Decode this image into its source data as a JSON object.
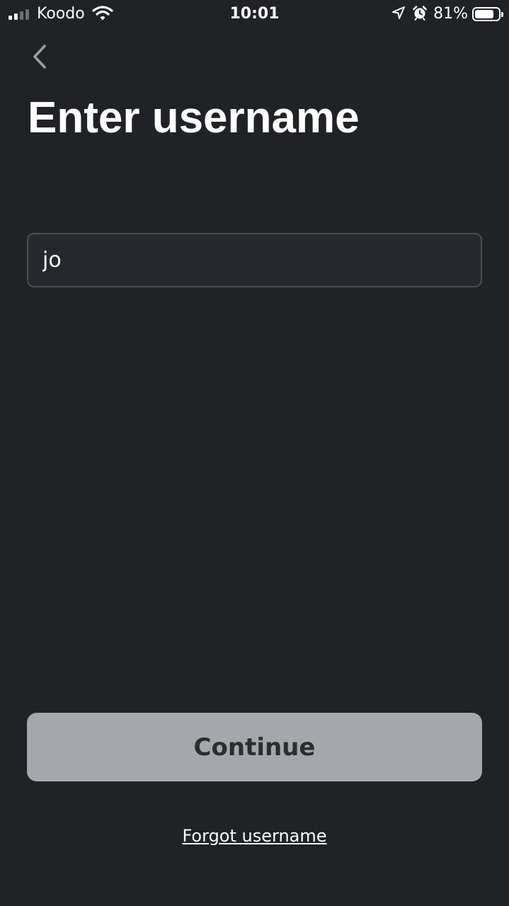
{
  "status_bar": {
    "carrier": "Koodo",
    "time": "10:01",
    "battery_percent": "81%",
    "battery_level": 0.81,
    "signal_bars_filled": 2,
    "signal_bars_total": 4,
    "icons": [
      "signal-icon",
      "wifi-icon",
      "location-arrow-icon",
      "alarm-clock-icon",
      "battery-icon"
    ]
  },
  "nav": {
    "back_icon": "chevron-left-icon"
  },
  "page": {
    "title": "Enter username"
  },
  "form": {
    "username_value": "jo",
    "continue_label": "Continue",
    "forgot_label": "Forgot username"
  },
  "colors": {
    "background": "#202226",
    "input_background": "#25282d",
    "input_border": "#4a4d53",
    "button_disabled_background": "#a4a7ab",
    "button_disabled_text": "#2b2d31",
    "text": "#ffffff"
  }
}
